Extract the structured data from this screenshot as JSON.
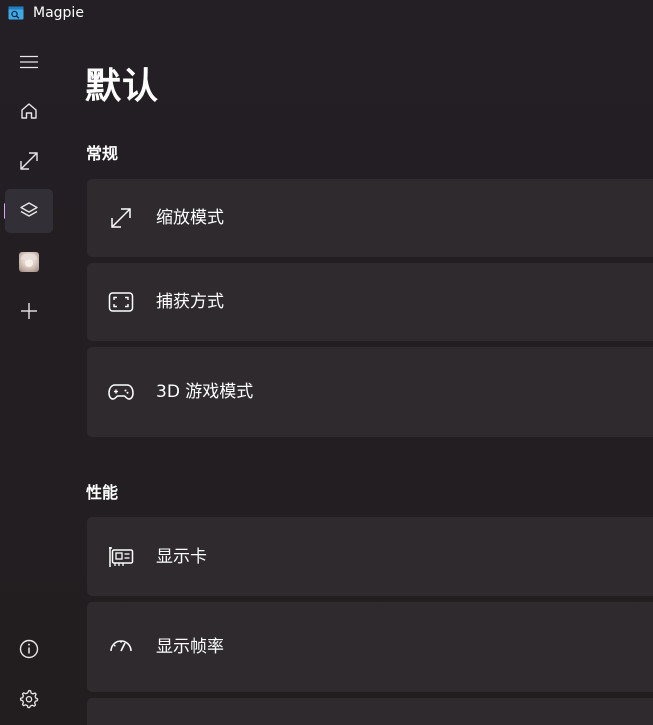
{
  "window": {
    "title": "Magpie"
  },
  "nav": {
    "items": [
      {
        "icon": "hamburger-menu-icon"
      },
      {
        "icon": "home-icon"
      },
      {
        "icon": "scale-arrows-icon"
      },
      {
        "icon": "layers-icon",
        "selected": true
      },
      {
        "icon": "avatar-profile"
      },
      {
        "icon": "add-icon"
      },
      {
        "icon": "info-icon"
      },
      {
        "icon": "settings-gear-icon"
      }
    ],
    "indicator_color": "#d9a7f2"
  },
  "page": {
    "title": "默认"
  },
  "sections": {
    "general": {
      "title": "常规",
      "items": [
        {
          "label": "缩放模式",
          "icon": "scale-arrows-icon"
        },
        {
          "label": "捕获方式",
          "icon": "capture-frame-icon"
        },
        {
          "label": "3D 游戏模式",
          "icon": "gamepad-icon"
        }
      ]
    },
    "performance": {
      "title": "性能",
      "items": [
        {
          "label": "显示卡",
          "icon": "graphics-card-icon"
        },
        {
          "label": "显示帧率",
          "icon": "speedometer-icon"
        }
      ]
    }
  },
  "colors": {
    "background": "#221e22",
    "card": "#2e2a2e",
    "accent": "#d9a7f2"
  }
}
